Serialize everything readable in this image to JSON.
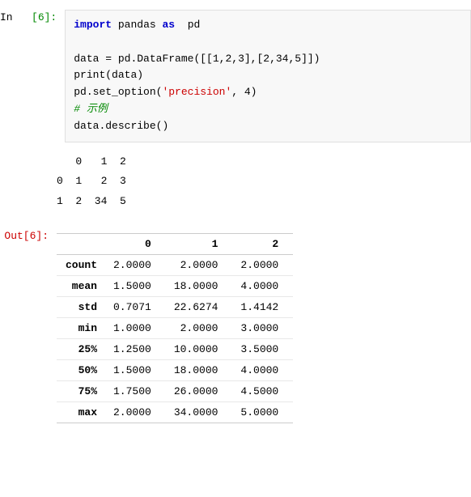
{
  "cell_in": {
    "label_in": "In",
    "label_num": "[6]:",
    "lines": [
      {
        "type": "code",
        "parts": [
          {
            "text": "import",
            "cls": "kw"
          },
          {
            "text": " pandas ",
            "cls": "func"
          },
          {
            "text": "as",
            "cls": "kw"
          },
          {
            "text": " pd",
            "cls": "func"
          }
        ]
      },
      {
        "type": "blank"
      },
      {
        "type": "code",
        "parts": [
          {
            "text": "data = pd.DataFrame([[1,2,3],[2,34,5]])",
            "cls": "func"
          }
        ]
      },
      {
        "type": "code",
        "parts": [
          {
            "text": "print(data)",
            "cls": "func"
          }
        ]
      },
      {
        "type": "code",
        "parts": [
          {
            "text": "pd.set_option(",
            "cls": "func"
          },
          {
            "text": "'precision'",
            "cls": "str"
          },
          {
            "text": ", 4)",
            "cls": "func"
          }
        ]
      },
      {
        "type": "code",
        "parts": [
          {
            "text": "# 示例",
            "cls": "comment"
          }
        ]
      },
      {
        "type": "code",
        "parts": [
          {
            "text": "data.describe()",
            "cls": "func"
          }
        ]
      }
    ]
  },
  "print_output": {
    "lines": [
      "   0   1  2",
      "0  1   2  3",
      "1  2  34  5"
    ]
  },
  "out_label": "Out[6]:",
  "table": {
    "headers": [
      "",
      "0",
      "1",
      "2"
    ],
    "rows": [
      {
        "label": "count",
        "v0": "2.0000",
        "v1": "2.0000",
        "v2": "2.0000"
      },
      {
        "label": "mean",
        "v0": "1.5000",
        "v1": "18.0000",
        "v2": "4.0000"
      },
      {
        "label": "std",
        "v0": "0.7071",
        "v1": "22.6274",
        "v2": "1.4142"
      },
      {
        "label": "min",
        "v0": "1.0000",
        "v1": "2.0000",
        "v2": "3.0000"
      },
      {
        "label": "25%",
        "v0": "1.2500",
        "v1": "10.0000",
        "v2": "3.5000"
      },
      {
        "label": "50%",
        "v0": "1.5000",
        "v1": "18.0000",
        "v2": "4.0000"
      },
      {
        "label": "75%",
        "v0": "1.7500",
        "v1": "26.0000",
        "v2": "4.5000"
      },
      {
        "label": "max",
        "v0": "2.0000",
        "v1": "34.0000",
        "v2": "5.0000"
      }
    ]
  }
}
